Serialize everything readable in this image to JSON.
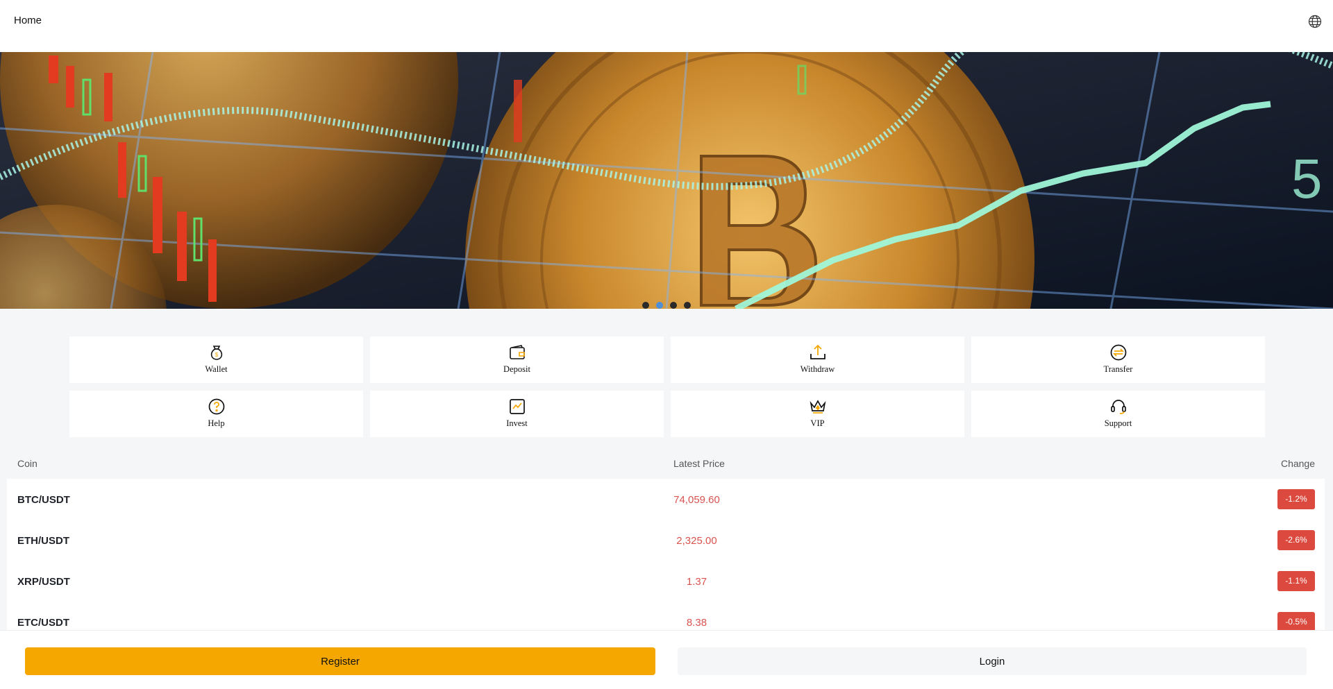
{
  "header": {
    "title": "Home",
    "language_icon": "globe-icon"
  },
  "banner": {
    "slides": 4,
    "active_slide": 2
  },
  "menu": {
    "items": [
      {
        "label": "Wallet",
        "icon": "money-bag-icon"
      },
      {
        "label": "Deposit",
        "icon": "wallet-icon"
      },
      {
        "label": "Withdraw",
        "icon": "upload-icon"
      },
      {
        "label": "Transfer",
        "icon": "transfer-icon"
      },
      {
        "label": "Help",
        "icon": "help-icon"
      },
      {
        "label": "Invest",
        "icon": "chart-icon"
      },
      {
        "label": "VIP",
        "icon": "crown-icon"
      },
      {
        "label": "Support",
        "icon": "headset-icon"
      }
    ]
  },
  "market": {
    "headers": {
      "coin": "Coin",
      "price": "Latest Price",
      "change": "Change"
    },
    "rows": [
      {
        "coin": "BTC/USDT",
        "price": "74,059.60",
        "change": "-1.2%"
      },
      {
        "coin": "ETH/USDT",
        "price": "2,325.00",
        "change": "-2.6%"
      },
      {
        "coin": "XRP/USDT",
        "price": "1.37",
        "change": "-1.1%"
      },
      {
        "coin": "ETC/USDT",
        "price": "8.38",
        "change": "-0.5%"
      }
    ]
  },
  "footer": {
    "register_label": "Register",
    "login_label": "Login"
  },
  "colors": {
    "accent": "#f5a700",
    "negative": "#dc4a3f",
    "dot_active": "#4f8fd6"
  }
}
